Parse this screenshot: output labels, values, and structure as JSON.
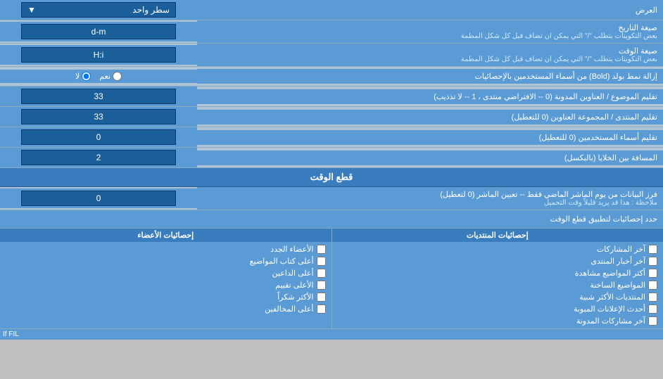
{
  "header": {
    "label_display": "العرض",
    "dropdown_label": "سطر واحد"
  },
  "date_format": {
    "label": "صيغة التاريخ",
    "sublabel": "بعض التكوينات يتطلب \"/\" التي يمكن ان تضاف قبل كل شكل المطمة",
    "value": "d-m"
  },
  "time_format": {
    "label": "صيغة الوقت",
    "sublabel": "بعض التكوينات يتطلب \"/\" التي يمكن ان تضاف قبل كل شكل المطمة",
    "value": "H:i"
  },
  "bold_remove": {
    "label": "إزالة نمط بولد (Bold) من أسماء المستخدمين بالإحصائيات",
    "radio_yes": "نعم",
    "radio_no": "لا",
    "selected": "no"
  },
  "forum_topic_align": {
    "label": "تقليم الموضوع / العناوين المدونة (0 -- الافتراضي منتدى ، 1 -- لا تذذيب)",
    "value": "33"
  },
  "forum_group_align": {
    "label": "تقليم المنتدى / المجموعة العناوين (0 للتعطيل)",
    "value": "33"
  },
  "user_names_trim": {
    "label": "تقليم أسماء المستخدمين (0 للتعطيل)",
    "value": "0"
  },
  "cell_spacing": {
    "label": "المسافة بين الخلايا (بالبكسل)",
    "value": "2"
  },
  "realtime_section": {
    "title": "قطع الوقت"
  },
  "realtime_filter": {
    "label": "فرز البيانات من يوم الماشر الماضي فقط -- تعيين الماشر (0 لتعطيل)",
    "note": "ملاحظة : هذا قد يزيد قليلاً وقت التحميل",
    "value": "0"
  },
  "stats_limit_label": "حدد إحصائيات لتطبيق قطع الوقت",
  "stats_posts": {
    "header": "إحصائيات المنتديات",
    "items": [
      "آخر المشاركات",
      "آخر أخبار المنتدى",
      "أكثر المواضيع مشاهدة",
      "المواضيع الساخنة",
      "المنتديات الأكثر شبية",
      "أحدث الإعلانات المبوبة",
      "آخر مشاركات المدونة"
    ]
  },
  "stats_members": {
    "header": "إحصائيات الأعضاء",
    "items": [
      "الأعضاء الجدد",
      "أعلى كتاب المواضيع",
      "أعلى الداعين",
      "الأعلى تقييم",
      "الأكثر شكراً",
      "أعلى المخالفين"
    ]
  },
  "footer_text": "If FIL"
}
